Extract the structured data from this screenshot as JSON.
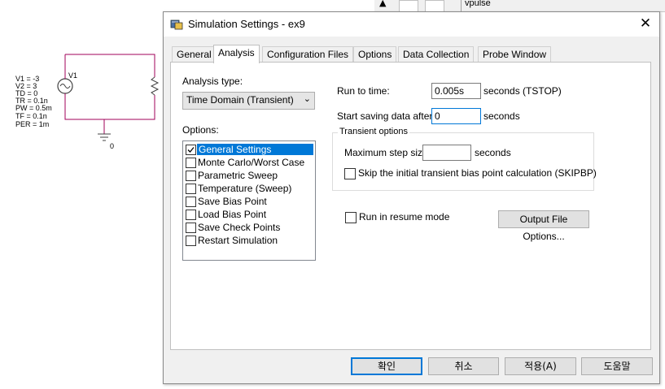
{
  "background": {
    "schematic_labels": [
      "V1 = -3",
      "V2 = 3",
      "TD = 0",
      "TR = 0.1n",
      "PW = 0.5m",
      "TF = 0.1n",
      "PER = 1m"
    ],
    "source_name": "V1",
    "ground_label": "0",
    "top_right_label": "vpulse"
  },
  "dialog": {
    "title": "Simulation Settings - ex9",
    "close_glyph": "✕",
    "tabs": [
      {
        "label": "General",
        "active": false
      },
      {
        "label": "Analysis",
        "active": true
      },
      {
        "label": "Configuration Files",
        "active": false
      },
      {
        "label": "Options",
        "active": false
      },
      {
        "label": "Data Collection",
        "active": false
      },
      {
        "label": "Probe Window",
        "active": false
      }
    ],
    "analysis": {
      "analysis_type_label": "Analysis type:",
      "analysis_type_value": "Time Domain (Transient)",
      "options_label": "Options:",
      "options": [
        {
          "label": "General Settings",
          "checked": true,
          "selected": true
        },
        {
          "label": "Monte Carlo/Worst Case",
          "checked": false,
          "selected": false
        },
        {
          "label": "Parametric Sweep",
          "checked": false,
          "selected": false
        },
        {
          "label": "Temperature (Sweep)",
          "checked": false,
          "selected": false
        },
        {
          "label": "Save Bias Point",
          "checked": false,
          "selected": false
        },
        {
          "label": "Load Bias Point",
          "checked": false,
          "selected": false
        },
        {
          "label": "Save Check Points",
          "checked": false,
          "selected": false
        },
        {
          "label": "Restart Simulation",
          "checked": false,
          "selected": false
        }
      ],
      "run_to_time_label": "Run to time:",
      "run_to_time_value": "0.005s",
      "run_to_time_unit": "seconds  (TSTOP)",
      "start_saving_label": "Start saving data after:",
      "start_saving_value": "0",
      "start_saving_unit": "seconds",
      "transient_group_title": "Transient options",
      "max_step_label": "Maximum step size:",
      "max_step_value": "",
      "max_step_unit": "seconds",
      "skip_bias_label": "Skip the initial transient bias point calculation  (SKIPBP)",
      "skip_bias_checked": false,
      "resume_label": "Run in resume mode",
      "resume_checked": false,
      "output_file_options_label": "Output File Options..."
    },
    "buttons": {
      "ok": "확인",
      "cancel": "취소",
      "apply": "적용(A)",
      "help": "도움말"
    }
  },
  "colors": {
    "accent": "#0078d7",
    "schematic_wire": "#a0005a"
  }
}
